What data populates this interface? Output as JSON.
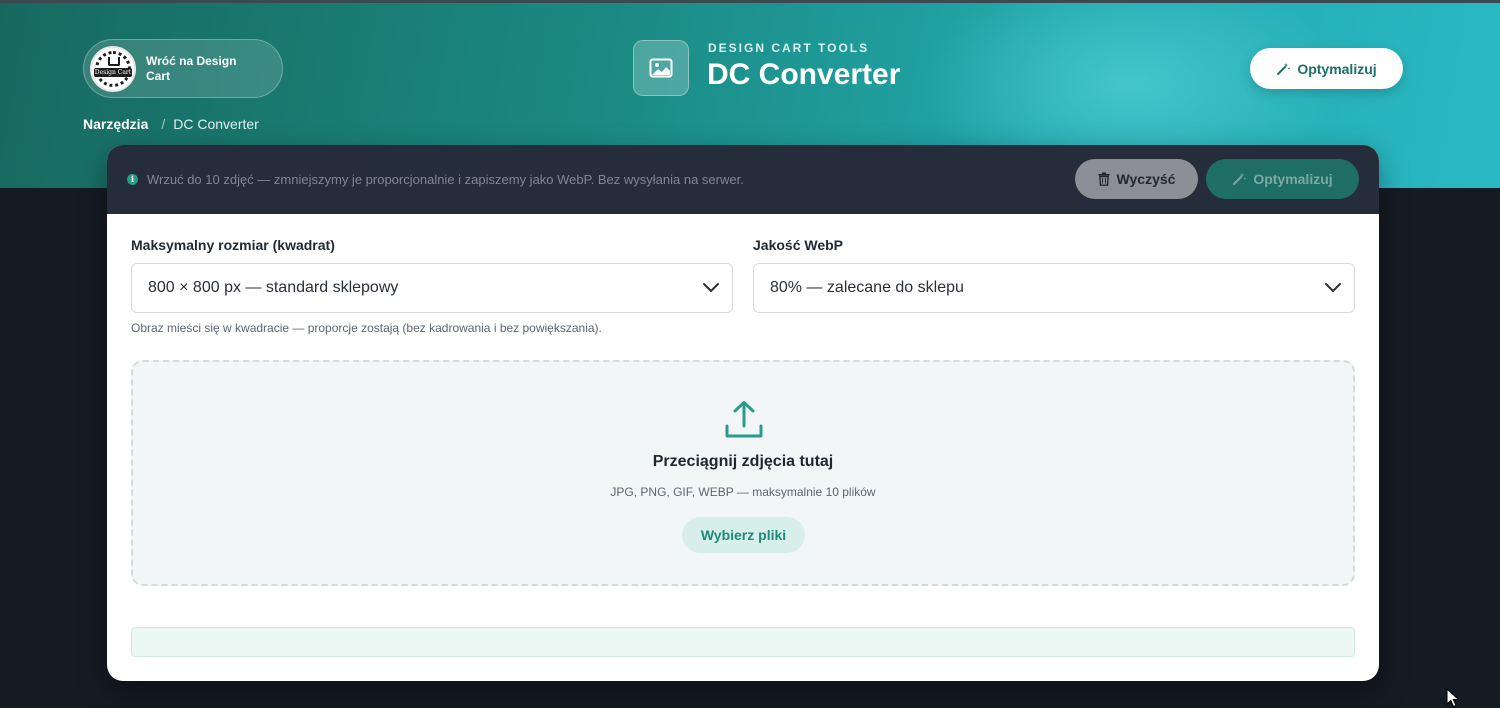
{
  "header": {
    "back_button_label": "Wróć na Design Cart",
    "logo_text": "Design Cart",
    "breadcrumb": {
      "root": "Narzędzia",
      "separator": "/",
      "current": "DC Converter"
    },
    "kicker": "DESIGN CART TOOLS",
    "title": "DC Converter",
    "optimize_label": "Optymalizuj"
  },
  "toolbar": {
    "info_text": "Wrzuć do 10 zdjęć — zmniejszymy je proporcjonalnie i zapiszemy jako WebP. Bez wysyłania na serwer.",
    "clear_label": "Wyczyść",
    "optimize_label": "Optymalizuj",
    "optimize_disabled": true
  },
  "settings": {
    "size_label": "Maksymalny rozmiar (kwadrat)",
    "size_value": "800 × 800 px — standard sklepowy",
    "quality_label": "Jakość WebP",
    "quality_value": "80% — zalecane do sklepu",
    "hint": "Obraz mieści się w kwadracie — proporcje zostają (bez kadrowania i bez powiększania)."
  },
  "dropzone": {
    "title": "Przeciągnij zdjęcia tutaj",
    "subtitle": "JPG, PNG, GIF, WEBP — maksymalnie 10 plików",
    "button_label": "Wybierz pliki"
  },
  "status": {
    "text": ""
  },
  "colors": {
    "accent": "#1e8a7a",
    "header_gradient_start": "#17695f",
    "header_gradient_end": "#2ab9c4",
    "page_background": "#141b22",
    "toolbar_background": "#252c3a"
  }
}
